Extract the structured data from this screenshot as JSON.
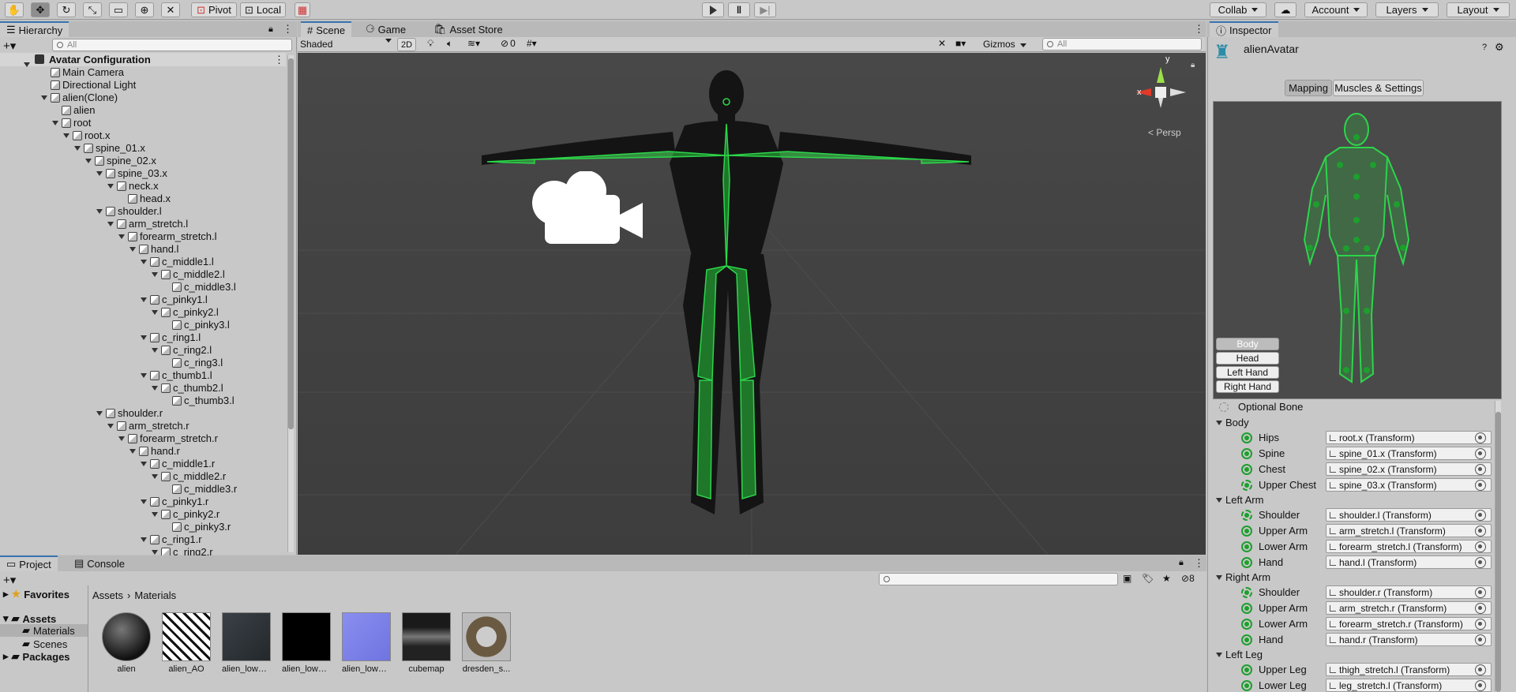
{
  "toolbar": {
    "pivot": "Pivot",
    "local": "Local",
    "collab": "Collab",
    "account": "Account",
    "layers": "Layers",
    "layout": "Layout"
  },
  "hierarchy": {
    "tab": "Hierarchy",
    "search_placeholder": "All",
    "scene": "Avatar Configuration",
    "items": [
      "Main Camera",
      "Directional Light",
      "alien(Clone)",
      "alien",
      "root",
      "root.x",
      "spine_01.x",
      "spine_02.x",
      "spine_03.x",
      "neck.x",
      "head.x",
      "shoulder.l",
      "arm_stretch.l",
      "forearm_stretch.l",
      "hand.l",
      "c_middle1.l",
      "c_middle2.l",
      "c_middle3.l",
      "c_pinky1.l",
      "c_pinky2.l",
      "c_pinky3.l",
      "c_ring1.l",
      "c_ring2.l",
      "c_ring3.l",
      "c_thumb1.l",
      "c_thumb2.l",
      "c_thumb3.l",
      "shoulder.r",
      "arm_stretch.r",
      "forearm_stretch.r",
      "hand.r",
      "c_middle1.r",
      "c_middle2.r",
      "c_middle3.r",
      "c_pinky1.r",
      "c_pinky2.r",
      "c_pinky3.r",
      "c_ring1.r",
      "c_ring2.r"
    ]
  },
  "scene": {
    "tabs": [
      "Scene",
      "Game",
      "Asset Store"
    ],
    "shading": "Shaded",
    "mode2d": "2D",
    "hidden_count": "0",
    "gizmos": "Gizmos",
    "search_placeholder": "All",
    "persp": "< Persp",
    "axis_y": "y",
    "axis_x": "x"
  },
  "inspector": {
    "tab": "Inspector",
    "object_name": "alienAvatar",
    "subtabs": [
      "Mapping",
      "Muscles & Settings"
    ],
    "body_buttons": [
      "Body",
      "Head",
      "Left Hand",
      "Right Hand"
    ],
    "optional_bone": "Optional Bone",
    "sections": [
      {
        "name": "Body",
        "bones": [
          {
            "label": "Hips",
            "value": "root.x (Transform)"
          },
          {
            "label": "Spine",
            "value": "spine_01.x (Transform)"
          },
          {
            "label": "Chest",
            "value": "spine_02.x (Transform)"
          },
          {
            "label": "Upper Chest",
            "value": "spine_03.x (Transform)"
          }
        ]
      },
      {
        "name": "Left Arm",
        "bones": [
          {
            "label": "Shoulder",
            "value": "shoulder.l (Transform)"
          },
          {
            "label": "Upper Arm",
            "value": "arm_stretch.l (Transform)"
          },
          {
            "label": "Lower Arm",
            "value": "forearm_stretch.l (Transform)"
          },
          {
            "label": "Hand",
            "value": "hand.l (Transform)"
          }
        ]
      },
      {
        "name": "Right Arm",
        "bones": [
          {
            "label": "Shoulder",
            "value": "shoulder.r (Transform)"
          },
          {
            "label": "Upper Arm",
            "value": "arm_stretch.r (Transform)"
          },
          {
            "label": "Lower Arm",
            "value": "forearm_stretch.r (Transform)"
          },
          {
            "label": "Hand",
            "value": "hand.r (Transform)"
          }
        ]
      },
      {
        "name": "Left Leg",
        "bones": [
          {
            "label": "Upper Leg",
            "value": "thigh_stretch.l (Transform)"
          },
          {
            "label": "Lower Leg",
            "value": "leg_stretch.l (Transform)"
          }
        ]
      }
    ]
  },
  "project": {
    "tabs": [
      "Project",
      "Console"
    ],
    "tree": [
      "Favorites",
      "Assets",
      "Materials",
      "Scenes",
      "Packages"
    ],
    "breadcrumb": [
      "Assets",
      "Materials"
    ],
    "hidden_count": "8",
    "assets": [
      "alien",
      "alien_AO",
      "alien_low_al...",
      "alien_low_al...",
      "alien_low_al...",
      "cubemap",
      "dresden_s..."
    ]
  }
}
